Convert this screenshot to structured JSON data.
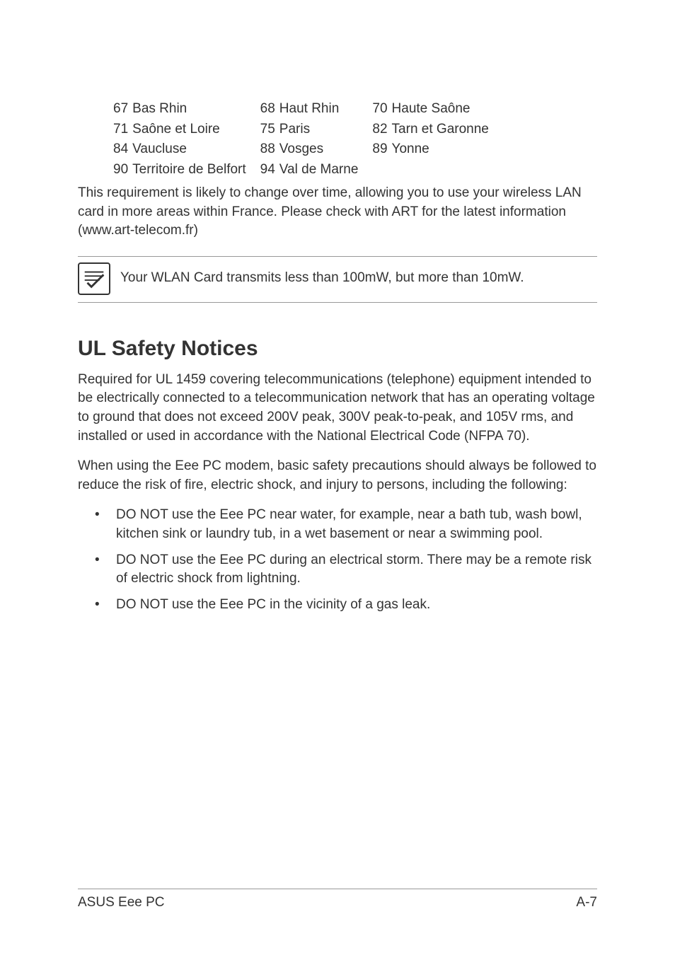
{
  "departments": {
    "rows": [
      [
        {
          "code": "67",
          "name": "Bas Rhin"
        },
        {
          "code": "68",
          "name": "Haut Rhin"
        },
        {
          "code": "70",
          "name": "Haute Saône"
        }
      ],
      [
        {
          "code": "71",
          "name": "Saône et Loire"
        },
        {
          "code": "75",
          "name": "Paris"
        },
        {
          "code": "82",
          "name": "Tarn et Garonne"
        }
      ],
      [
        {
          "code": "84",
          "name": "Vaucluse"
        },
        {
          "code": "88",
          "name": "Vosges"
        },
        {
          "code": "89",
          "name": "Yonne"
        }
      ],
      [
        {
          "code": "90",
          "name": "Territoire de Belfort"
        },
        {
          "code": "94",
          "name": "Val de Marne"
        }
      ]
    ]
  },
  "requirement_para": "This requirement is likely to change over time, allowing you to use your wireless LAN card in more areas within France. Please check with ART for the latest information (www.art-telecom.fr)",
  "note_text": "Your WLAN Card transmits less than 100mW, but more than 10mW.",
  "ul_heading": "UL Safety Notices",
  "ul_para1": "Required for UL 1459 covering telecommunications (telephone) equipment intended to be electrically connected to a telecommunication network that has an operating voltage to ground that does not exceed 200V peak, 300V peak-to-peak, and 105V rms, and installed or used in accordance with the National Electrical Code (NFPA 70).",
  "ul_para2": "When using the Eee PC modem, basic safety precautions should always be followed to reduce the risk of fire, electric shock, and injury to persons, including the following:",
  "bullets": [
    "DO NOT use the Eee PC near water, for example, near a bath tub, wash bowl, kitchen sink or laundry tub, in a wet basement or near a swimming pool.",
    "DO NOT use the Eee PC during an electrical storm. There may be a remote risk of electric shock from lightning.",
    "DO NOT use the Eee PC in the vicinity of a gas leak."
  ],
  "footer_left": "ASUS Eee PC",
  "footer_right": "A-7"
}
